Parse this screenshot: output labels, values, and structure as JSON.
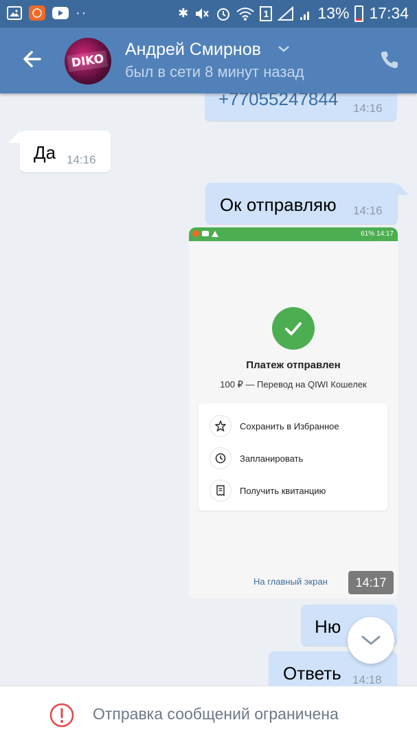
{
  "status_bar": {
    "battery_percent": "13%",
    "time": "17:34",
    "sim_slot": "1",
    "notif_icons": [
      "image-icon",
      "app-icon",
      "youtube-icon",
      "more-dots-icon"
    ],
    "battery_level": 0.13
  },
  "header": {
    "contact_name": "Андрей Смирнов",
    "contact_status": "был в сети 8 минут назад",
    "avatar_text": "DIKO"
  },
  "messages": [
    {
      "direction": "out",
      "text": "+77055247844",
      "time": "14:16"
    },
    {
      "direction": "in",
      "text": "Да",
      "time": "14:16"
    },
    {
      "direction": "out",
      "text": "Ок отправляю",
      "time": "14:16"
    },
    {
      "direction": "out",
      "type": "image",
      "time": "14:17"
    },
    {
      "direction": "out",
      "text": "Ню",
      "time": ""
    },
    {
      "direction": "out",
      "text": "Ответь",
      "time": "14:18"
    }
  ],
  "attachment": {
    "status_bar_right": "61% 14:17",
    "title": "Платеж отправлен",
    "subtitle": "100 ₽ — Перевод на QIWI Кошелек",
    "actions": [
      {
        "label": "Сохранить в Избранное",
        "icon": "star-icon"
      },
      {
        "label": "Запланировать",
        "icon": "clock-icon"
      },
      {
        "label": "Получить квитанцию",
        "icon": "receipt-icon"
      }
    ],
    "home_link": "На главный экран"
  },
  "bottom_bar": {
    "text": "Отправка сообщений ограничена"
  },
  "colors": {
    "status_bar": "#3d6a9c",
    "header": "#5181b8",
    "chat_background": "#ecf0f4",
    "incoming_bubble": "#ffffff",
    "outgoing_bubble": "#cfe2fa",
    "success_green": "#4cae50",
    "warning_red": "#e64646"
  }
}
